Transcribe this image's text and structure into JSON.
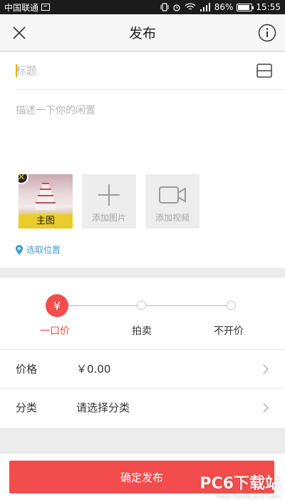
{
  "status_bar": {
    "carrier": "中国联通",
    "battery": "86%",
    "time": "15:55"
  },
  "nav": {
    "title": "发布",
    "close_icon": "close-icon",
    "info_icon": "info-icon"
  },
  "form": {
    "title_placeholder": "标题",
    "description_placeholder": "描述一下你的闲置",
    "main_image_label": "主图",
    "add_image_label": "添加图片",
    "add_video_label": "添加视频",
    "location_label": "选取位置"
  },
  "price_mode": {
    "selected_symbol": "¥",
    "options": [
      "一口价",
      "拍卖",
      "不开价"
    ],
    "selected_index": 0
  },
  "fields": {
    "price_key": "价格",
    "price_value": "￥0.00",
    "category_key": "分类",
    "category_value": "请选择分类"
  },
  "footer": {
    "submit_label": "确定发布",
    "watermark_brand": "PC6下载站",
    "watermark_url": "http://www.pc6.com"
  },
  "colors": {
    "accent": "#f34c4c",
    "location_blue": "#3fa0d8",
    "badge_yellow": "#f5c400"
  }
}
